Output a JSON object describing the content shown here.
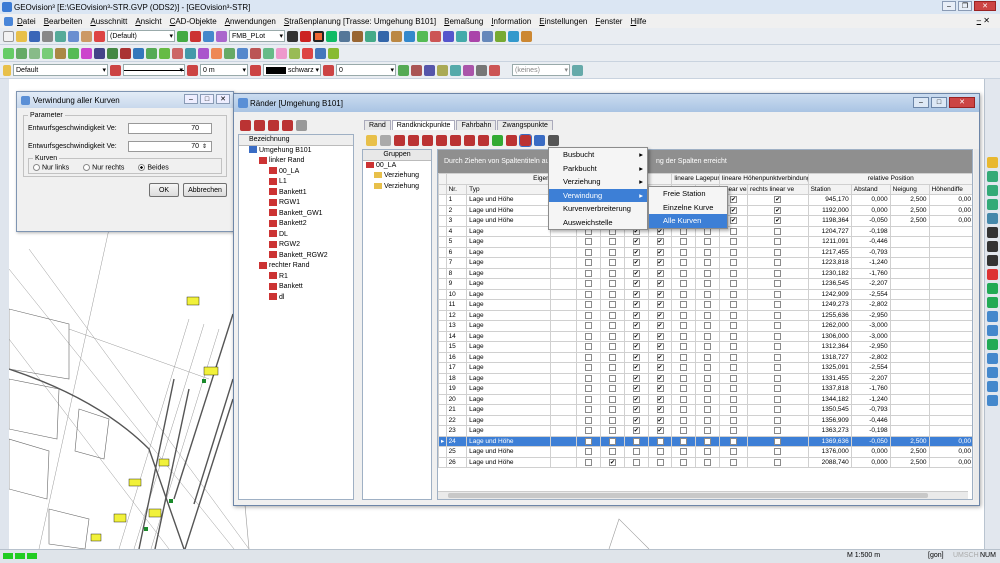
{
  "app": {
    "title": "GEOvision³ [E:\\GEOvision³-STR.GVP (ODS2)] - [GEOvision³-STR]"
  },
  "menu": [
    "Datei",
    "Bearbeiten",
    "Ausschnitt",
    "Ansicht",
    "CAD-Objekte",
    "Anwendungen",
    "Straßenplanung [Trasse: Umgehung B101]",
    "Bemaßung",
    "Information",
    "Einstellungen",
    "Fenster",
    "Hilfe"
  ],
  "toolbar": {
    "layer_combo": "(Default)",
    "plot_combo": "FMB_PLot",
    "style_combo": "Default",
    "offset_combo": "0 m",
    "color_combo": "schwarz",
    "num_combo": "0",
    "keines_combo": "(keines)"
  },
  "dialog": {
    "title": "Verwindung aller Kurven",
    "group_parameter": "Parameter",
    "label_ve1": "Entwurfsgeschwindigkeit Ve:",
    "value_ve1": "70",
    "label_ve2": "Entwurfsgeschwindigkeit Ve:",
    "value_ve2": "70",
    "group_kurven": "Kurven",
    "opt_links": "Nur links",
    "opt_rechts": "Nur rechts",
    "opt_beides": "Beides",
    "ok": "OK",
    "cancel": "Abbrechen"
  },
  "main": {
    "title": "Ränder [Umgehung B101]",
    "tree_header": "Bezeichnung",
    "tree": [
      {
        "label": "Umgehung B101",
        "indent": 0
      },
      {
        "label": "linker Rand",
        "indent": 1
      },
      {
        "label": "00_LA",
        "indent": 2
      },
      {
        "label": "L1",
        "indent": 2
      },
      {
        "label": "Bankett1",
        "indent": 2
      },
      {
        "label": "RGW1",
        "indent": 2
      },
      {
        "label": "Bankett_GW1",
        "indent": 2
      },
      {
        "label": "Bankett2",
        "indent": 2
      },
      {
        "label": "DL",
        "indent": 2
      },
      {
        "label": "RGW2",
        "indent": 2
      },
      {
        "label": "Bankett_RGW2",
        "indent": 2
      },
      {
        "label": "rechter Rand",
        "indent": 1
      },
      {
        "label": "R1",
        "indent": 2
      },
      {
        "label": "Bankett",
        "indent": 2
      },
      {
        "label": "dl",
        "indent": 2
      }
    ],
    "tabs": [
      "Rand",
      "Randknickpunkte",
      "Fahrbahn",
      "Zwangspunkte"
    ],
    "groups_header": "Gruppen",
    "groups": [
      {
        "label": "00_LA",
        "indent": 0
      },
      {
        "label": "Verziehung",
        "indent": 1
      },
      {
        "label": "Verziehung",
        "indent": 1
      }
    ],
    "hint_left": "Durch Ziehen von Spaltentiteln auf",
    "hint_right": "ng der Spalten erreicht",
    "headers": {
      "eig": "Eigenschaften",
      "lage": "lineare Lagepunktv",
      "hoehe": "lineare Höhenpunktverbindung",
      "relpos": "relative Position",
      "nr": "Nr.",
      "typ": "Typ",
      "ab": "ab",
      "links": "linear verb",
      "rechts": "rechts linear ve",
      "station": "Station",
      "abstand": "Abstand",
      "neigung": "Neigung",
      "hdiff": "Höhendiffe"
    },
    "rows": [
      {
        "nr": "1",
        "typ": "Lage und Höhe",
        "station": "945,170",
        "abstand": "0,000",
        "neigung": "2,500",
        "hdiff": "0,00",
        "c": [
          0,
          0,
          0,
          0,
          0,
          0,
          1,
          1
        ]
      },
      {
        "nr": "2",
        "typ": "Lage und Höhe",
        "station": "1192,000",
        "abstand": "0,000",
        "neigung": "2,500",
        "hdiff": "0,00",
        "c": [
          0,
          0,
          0,
          0,
          0,
          0,
          1,
          1
        ]
      },
      {
        "nr": "3",
        "typ": "Lage und Höhe",
        "station": "1198,364",
        "abstand": "-0,050",
        "neigung": "2,500",
        "hdiff": "0,00",
        "c": [
          0,
          0,
          0,
          0,
          0,
          0,
          1,
          1
        ]
      },
      {
        "nr": "4",
        "typ": "Lage",
        "station": "1204,727",
        "abstand": "-0,198",
        "neigung": "",
        "hdiff": "",
        "c": [
          0,
          0,
          1,
          1,
          0,
          0,
          0,
          0
        ]
      },
      {
        "nr": "5",
        "typ": "Lage",
        "station": "1211,091",
        "abstand": "-0,446",
        "neigung": "",
        "hdiff": "",
        "c": [
          0,
          0,
          1,
          1,
          0,
          0,
          0,
          0
        ]
      },
      {
        "nr": "6",
        "typ": "Lage",
        "station": "1217,455",
        "abstand": "-0,793",
        "neigung": "",
        "hdiff": "",
        "c": [
          0,
          0,
          1,
          1,
          0,
          0,
          0,
          0
        ]
      },
      {
        "nr": "7",
        "typ": "Lage",
        "station": "1223,818",
        "abstand": "-1,240",
        "neigung": "",
        "hdiff": "",
        "c": [
          0,
          0,
          1,
          1,
          0,
          0,
          0,
          0
        ]
      },
      {
        "nr": "8",
        "typ": "Lage",
        "station": "1230,182",
        "abstand": "-1,760",
        "neigung": "",
        "hdiff": "",
        "c": [
          0,
          0,
          1,
          1,
          0,
          0,
          0,
          0
        ]
      },
      {
        "nr": "9",
        "typ": "Lage",
        "station": "1236,545",
        "abstand": "-2,207",
        "neigung": "",
        "hdiff": "",
        "c": [
          0,
          0,
          1,
          1,
          0,
          0,
          0,
          0
        ]
      },
      {
        "nr": "10",
        "typ": "Lage",
        "station": "1242,909",
        "abstand": "-2,554",
        "neigung": "",
        "hdiff": "",
        "c": [
          0,
          0,
          1,
          1,
          0,
          0,
          0,
          0
        ]
      },
      {
        "nr": "11",
        "typ": "Lage",
        "station": "1249,273",
        "abstand": "-2,802",
        "neigung": "",
        "hdiff": "",
        "c": [
          0,
          0,
          1,
          1,
          0,
          0,
          0,
          0
        ]
      },
      {
        "nr": "12",
        "typ": "Lage",
        "station": "1255,636",
        "abstand": "-2,950",
        "neigung": "",
        "hdiff": "",
        "c": [
          0,
          0,
          1,
          1,
          0,
          0,
          0,
          0
        ]
      },
      {
        "nr": "13",
        "typ": "Lage",
        "station": "1262,000",
        "abstand": "-3,000",
        "neigung": "",
        "hdiff": "",
        "c": [
          0,
          0,
          1,
          1,
          0,
          0,
          0,
          0
        ]
      },
      {
        "nr": "14",
        "typ": "Lage",
        "station": "1306,000",
        "abstand": "-3,000",
        "neigung": "",
        "hdiff": "",
        "c": [
          0,
          0,
          1,
          1,
          0,
          0,
          0,
          0
        ]
      },
      {
        "nr": "15",
        "typ": "Lage",
        "station": "1312,364",
        "abstand": "-2,950",
        "neigung": "",
        "hdiff": "",
        "c": [
          0,
          0,
          1,
          1,
          0,
          0,
          0,
          0
        ]
      },
      {
        "nr": "16",
        "typ": "Lage",
        "station": "1318,727",
        "abstand": "-2,802",
        "neigung": "",
        "hdiff": "",
        "c": [
          0,
          0,
          1,
          1,
          0,
          0,
          0,
          0
        ]
      },
      {
        "nr": "17",
        "typ": "Lage",
        "station": "1325,091",
        "abstand": "-2,554",
        "neigung": "",
        "hdiff": "",
        "c": [
          0,
          0,
          1,
          1,
          0,
          0,
          0,
          0
        ]
      },
      {
        "nr": "18",
        "typ": "Lage",
        "station": "1331,455",
        "abstand": "-2,207",
        "neigung": "",
        "hdiff": "",
        "c": [
          0,
          0,
          1,
          1,
          0,
          0,
          0,
          0
        ]
      },
      {
        "nr": "19",
        "typ": "Lage",
        "station": "1337,818",
        "abstand": "-1,760",
        "neigung": "",
        "hdiff": "",
        "c": [
          0,
          0,
          1,
          1,
          0,
          0,
          0,
          0
        ]
      },
      {
        "nr": "20",
        "typ": "Lage",
        "station": "1344,182",
        "abstand": "-1,240",
        "neigung": "",
        "hdiff": "",
        "c": [
          0,
          0,
          1,
          1,
          0,
          0,
          0,
          0
        ]
      },
      {
        "nr": "21",
        "typ": "Lage",
        "station": "1350,545",
        "abstand": "-0,793",
        "neigung": "",
        "hdiff": "",
        "c": [
          0,
          0,
          1,
          1,
          0,
          0,
          0,
          0
        ]
      },
      {
        "nr": "22",
        "typ": "Lage",
        "station": "1356,909",
        "abstand": "-0,446",
        "neigung": "",
        "hdiff": "",
        "c": [
          0,
          0,
          1,
          1,
          0,
          0,
          0,
          0
        ]
      },
      {
        "nr": "23",
        "typ": "Lage",
        "station": "1363,273",
        "abstand": "-0,198",
        "neigung": "",
        "hdiff": "",
        "c": [
          0,
          0,
          1,
          1,
          0,
          0,
          0,
          0
        ]
      },
      {
        "nr": "24",
        "typ": "Lage und Höhe",
        "station": "1369,636",
        "abstand": "-0,050",
        "neigung": "2,500",
        "hdiff": "0,00",
        "c": [
          0,
          0,
          1,
          1,
          0,
          0,
          0,
          0
        ],
        "sel": true
      },
      {
        "nr": "25",
        "typ": "Lage und Höhe",
        "station": "1376,000",
        "abstand": "0,000",
        "neigung": "2,500",
        "hdiff": "0,00",
        "c": [
          0,
          0,
          0,
          0,
          0,
          0,
          0,
          0
        ]
      },
      {
        "nr": "26",
        "typ": "Lage und Höhe",
        "station": "2088,740",
        "abstand": "0,000",
        "neigung": "2,500",
        "hdiff": "0,00",
        "c": [
          0,
          1,
          0,
          0,
          0,
          0,
          0,
          0
        ]
      }
    ]
  },
  "context_menu": [
    "Busbucht",
    "Parkbucht",
    "Verziehung",
    "Verwindung",
    "Kurvenverbreiterung",
    "Ausweichstelle"
  ],
  "submenu": [
    "Freie Station",
    "Einzelne Kurve",
    "Alle Kurven"
  ],
  "status": {
    "scale": "M 1:500  m",
    "unit": "[gon]",
    "umsch": "UMSCH",
    "num": "NUM"
  }
}
